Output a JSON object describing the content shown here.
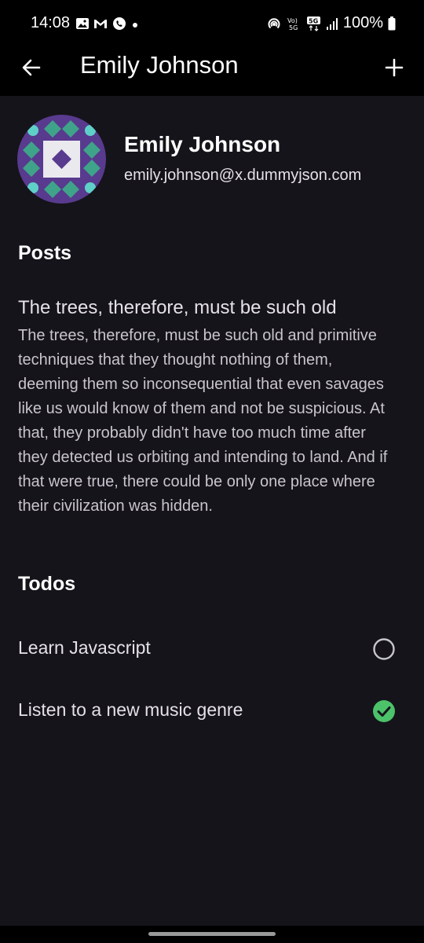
{
  "status_bar": {
    "time": "14:08",
    "battery": "100%",
    "left_icons": [
      "image-icon",
      "gmail-icon",
      "whatsapp-icon",
      "dot-icon"
    ],
    "right_icons": [
      "hotspot-icon",
      "volte-icon",
      "5g-icon",
      "signal-icon",
      "battery-icon"
    ]
  },
  "app_bar": {
    "title": "Emily Johnson",
    "back_icon": "arrow-left-icon",
    "add_icon": "plus-icon"
  },
  "profile": {
    "name": "Emily Johnson",
    "email": "emily.johnson@x.dummyjson.com",
    "avatar_icon": "identicon-avatar"
  },
  "posts": {
    "heading": "Posts",
    "items": [
      {
        "title": "The trees, therefore, must be such old",
        "body": "The trees, therefore, must be such old and primitive techniques that they thought nothing of them, deeming them so inconsequential that even savages like us would know of them and not be suspicious. At that, they probably didn't have too much time after they detected us orbiting and intending to land. And if that were true, there could be only one place where their civilization was hidden."
      }
    ]
  },
  "todos": {
    "heading": "Todos",
    "items": [
      {
        "label": "Learn Javascript",
        "completed": false
      },
      {
        "label": "Listen to a new music genre",
        "completed": true
      }
    ]
  },
  "colors": {
    "background": "#15141a",
    "bar": "#000000",
    "check_green": "#4cc26a",
    "avatar_purple": "#583a8e",
    "avatar_teal": "#3fa389"
  }
}
